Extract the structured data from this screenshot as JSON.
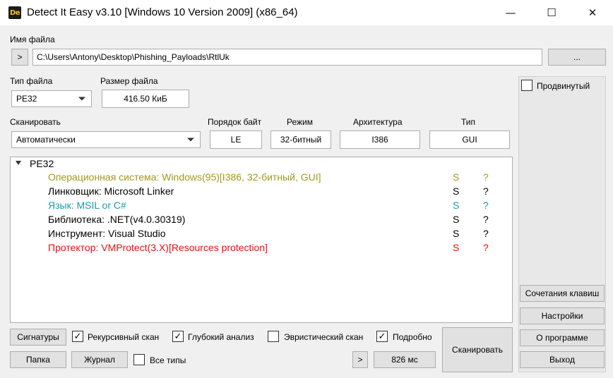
{
  "window": {
    "title": "Detect It Easy v3.10 [Windows 10 Version 2009] (x86_64)",
    "icon_text": "De",
    "minimize_glyph": "—",
    "maximize_glyph": "☐",
    "close_glyph": "✕"
  },
  "file": {
    "label": "Имя файла",
    "open_button": ">",
    "path": "C:\\Users\\Antony\\Desktop\\Phishing_Payloads\\RtlUk",
    "browse_button": "..."
  },
  "file_type": {
    "label": "Тип файла",
    "value": "PE32"
  },
  "file_size": {
    "label": "Размер файла",
    "value": "416.50 КиБ"
  },
  "scan_mode": {
    "label": "Сканировать",
    "value": "Автоматически"
  },
  "info": {
    "endianness_label": "Порядок байт",
    "endianness_value": "LE",
    "mode_label": "Режим",
    "mode_value": "32-битный",
    "arch_label": "Архитектура",
    "arch_value": "I386",
    "type_label": "Тип",
    "type_value": "GUI"
  },
  "results": {
    "root": "PE32",
    "rows": [
      {
        "text": "Операционная система: Windows(95)[I386, 32-битный, GUI]",
        "s": "S",
        "q": "?",
        "color": "#a09a1a"
      },
      {
        "text": "Линковщик: Microsoft Linker",
        "s": "S",
        "q": "?",
        "color": "#000000"
      },
      {
        "text": "Язык: MSIL or C#",
        "s": "S",
        "q": "?",
        "color": "#1a9aa8"
      },
      {
        "text": "Библиотека: .NET(v4.0.30319)",
        "s": "S",
        "q": "?",
        "color": "#000000"
      },
      {
        "text": "Инструмент: Visual Studio",
        "s": "S",
        "q": "?",
        "color": "#000000"
      },
      {
        "text": "Протектор: VMProtect(3.X)[Resources protection]",
        "s": "S",
        "q": "?",
        "color": "#e81010"
      }
    ]
  },
  "right_panel": {
    "advanced_label": "Продвинутый",
    "shortcuts_button": "Сочетания клавиш",
    "settings_button": "Настройки",
    "about_button": "О программе",
    "exit_button": "Выход"
  },
  "bottom": {
    "signatures_button": "Сигнатуры",
    "recursive_label": "Рекурсивный скан",
    "recursive_checked": true,
    "deep_label": "Глубокий анализ",
    "deep_checked": true,
    "heuristic_label": "Эвристический скан",
    "heuristic_checked": false,
    "verbose_label": "Подробно",
    "verbose_checked": true,
    "folder_button": "Папка",
    "log_button": "Журнал",
    "all_types_label": "Все типы",
    "all_types_checked": false,
    "next_button": ">",
    "time_value": "826 мс",
    "scan_button": "Сканировать",
    "check_glyph": "✓"
  }
}
